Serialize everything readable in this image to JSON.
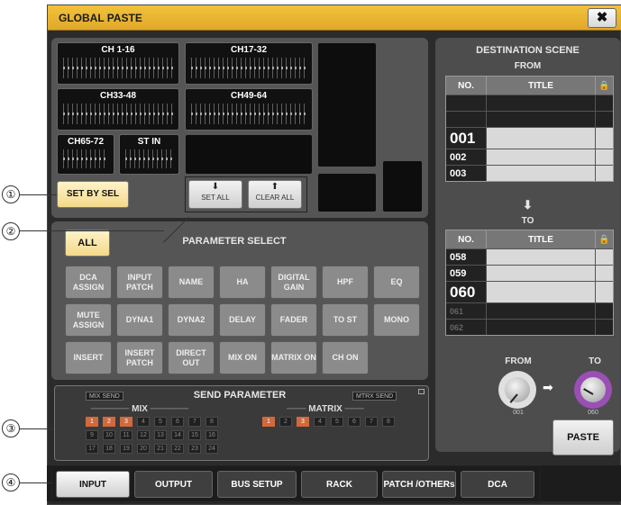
{
  "window": {
    "title": "GLOBAL PASTE",
    "close_label": "✖"
  },
  "channels": {
    "blocks": [
      "CH 1-16",
      "CH17-32",
      "CH33-48",
      "CH49-64",
      "CH65-72",
      "ST IN"
    ],
    "set_by_sel": "SET BY SEL",
    "set_all": "SET ALL",
    "clear_all": "CLEAR ALL"
  },
  "parameter_select": {
    "title": "PARAMETER SELECT",
    "all_label": "ALL",
    "buttons": [
      [
        "DCA ASSIGN",
        "INPUT PATCH",
        "NAME",
        "HA",
        "DIGITAL GAIN",
        "HPF",
        "EQ"
      ],
      [
        "MUTE ASSIGN",
        "DYNA1",
        "DYNA2",
        "DELAY",
        "FADER",
        "TO ST",
        "MONO"
      ],
      [
        "INSERT",
        "INSERT PATCH",
        "DIRECT OUT",
        "MIX ON",
        "MATRIX ON",
        "CH ON"
      ]
    ]
  },
  "send_parameter": {
    "title": "SEND PARAMETER",
    "mix_tag": "MIX SEND",
    "mtrx_tag": "MTRX SEND",
    "mix_label": "MIX",
    "matrix_label": "MATRIX",
    "mix_cells": [
      "1",
      "2",
      "3",
      "4",
      "5",
      "6",
      "7",
      "8",
      "9",
      "10",
      "11",
      "12",
      "13",
      "14",
      "15",
      "16",
      "17",
      "18",
      "19",
      "20",
      "21",
      "22",
      "23",
      "24"
    ],
    "mix_selected": [
      "1",
      "2",
      "3"
    ],
    "matrix_cells": [
      "1",
      "2",
      "3",
      "4",
      "5",
      "6",
      "7",
      "8"
    ],
    "matrix_selected": [
      "1",
      "3"
    ]
  },
  "destination": {
    "title": "DESTINATION SCENE",
    "from_label": "FROM",
    "to_label": "TO",
    "col_no": "NO.",
    "col_title": "TITLE",
    "from_rows": [
      "",
      "",
      "001",
      "002",
      "003"
    ],
    "to_rows": [
      "058",
      "059",
      "060",
      "061",
      "062"
    ],
    "arrow": "⬇",
    "knob_from_label": "FROM",
    "knob_to_label": "TO",
    "knob_from_value": "001",
    "knob_to_value": "060",
    "knob_arrow": "➡",
    "paste_label": "PASTE"
  },
  "tabs": [
    "INPUT",
    "OUTPUT",
    "BUS SETUP",
    "RACK",
    "PATCH /OTHERs",
    "DCA"
  ],
  "callouts": [
    "①",
    "②",
    "③",
    "④"
  ],
  "colors": {
    "title_bar": "#e8b432",
    "selected_cell": "#d2693c",
    "to_knob_ring": "#9b4fb5",
    "from_knob_ring": "#e0e0e0"
  }
}
